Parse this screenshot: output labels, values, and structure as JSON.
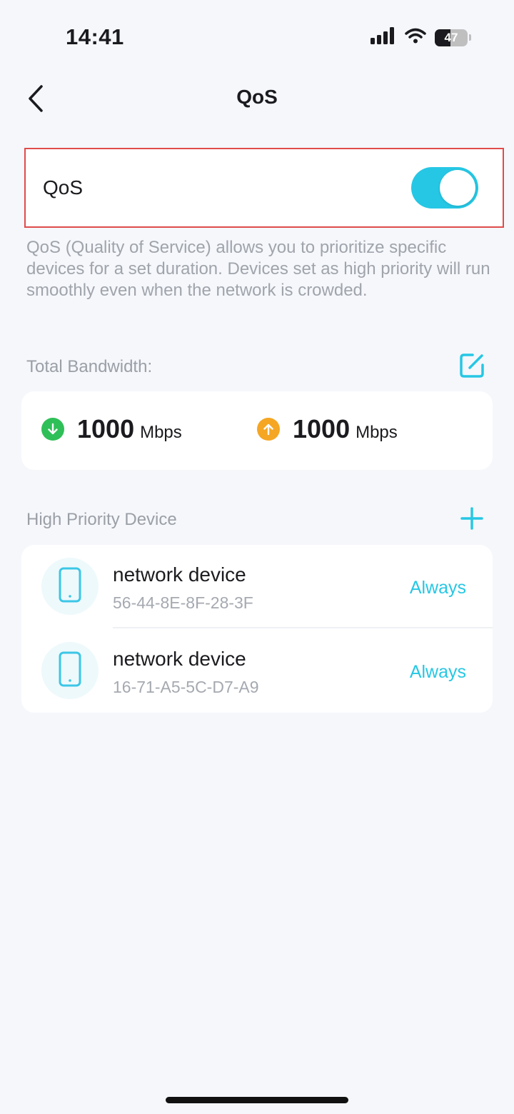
{
  "status_bar": {
    "time": "14:41",
    "battery_level": "47",
    "battery_fraction": 0.47,
    "icons": [
      "signal-icon",
      "wifi-icon",
      "battery-icon"
    ]
  },
  "nav": {
    "title": "QoS",
    "back_icon": "chevron-left-icon"
  },
  "qos": {
    "label": "QoS",
    "enabled": true
  },
  "description": "QoS (Quality of Service) allows you to prioritize specific devices for a set duration. Devices set as high priority will run smoothly even when the network is crowded.",
  "bandwidth": {
    "title": "Total Bandwidth:",
    "edit_icon": "edit-icon",
    "download": {
      "value": "1000",
      "unit": "Mbps",
      "icon": "download-arrow-icon"
    },
    "upload": {
      "value": "1000",
      "unit": "Mbps",
      "icon": "upload-arrow-icon"
    }
  },
  "priority": {
    "title": "High Priority Device",
    "add_icon": "plus-icon",
    "devices": [
      {
        "name": "network device",
        "mac": "56-44-8E-8F-28-3F",
        "schedule": "Always",
        "icon": "phone-icon"
      },
      {
        "name": "network device",
        "mac": "16-71-A5-5C-D7-A9",
        "schedule": "Always",
        "icon": "phone-icon"
      }
    ]
  },
  "colors": {
    "accent": "#26c7e4",
    "download": "#2fbf58",
    "upload": "#f5a623",
    "highlight_border": "#e04b4b",
    "background": "#f5f7fb"
  }
}
